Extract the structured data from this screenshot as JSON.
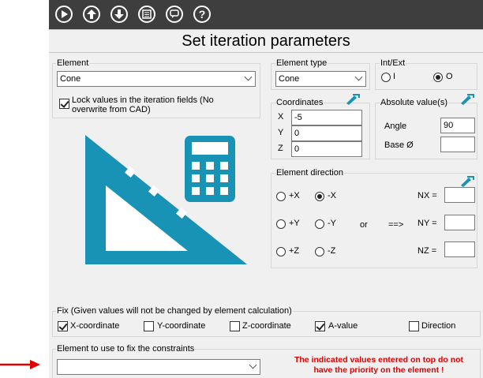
{
  "toolbar": {
    "buttons": [
      {
        "icon": "play-icon"
      },
      {
        "icon": "arrow-up-icon"
      },
      {
        "icon": "arrow-down-icon"
      },
      {
        "icon": "list-icon"
      },
      {
        "icon": "comment-icon"
      },
      {
        "icon": "help-icon",
        "glyph": "?"
      }
    ]
  },
  "title": "Set iteration parameters",
  "element": {
    "label": "Element",
    "value": "Cone",
    "lock_label": "Lock values in the iteration fields (No overwrite from CAD)",
    "lock_checked": true
  },
  "element_type": {
    "label": "Element type",
    "value": "Cone"
  },
  "int_ext": {
    "label": "Int/Ext",
    "options": [
      "I",
      "O"
    ],
    "selected": "O"
  },
  "coordinates": {
    "label": "Coordinates",
    "x_label": "X",
    "x_value": "-5",
    "y_label": "Y",
    "y_value": "0",
    "z_label": "Z",
    "z_value": "0"
  },
  "absolute_values": {
    "label": "Absolute value(s)",
    "angle_label": "Angle",
    "angle_value": "90",
    "base_label": "Base Ø",
    "base_value": ""
  },
  "direction": {
    "label": "Element direction",
    "px": "+X",
    "nx": "-X",
    "py": "+Y",
    "ny": "-Y",
    "pz": "+Z",
    "nz": "-Z",
    "selected": "-X",
    "or_label": "or",
    "arrow_label": "==>",
    "nx_label": "NX =",
    "ny_label": "NY =",
    "nz_label": "NZ =",
    "nx_value": "",
    "ny_value": "",
    "nz_value": ""
  },
  "fix": {
    "label": "Fix (Given values will not be changed by element calculation)",
    "x_label": "X-coordinate",
    "x_checked": true,
    "y_label": "Y-coordinate",
    "y_checked": false,
    "z_label": "Z-coordinate",
    "z_checked": false,
    "a_label": "A-value",
    "a_checked": true,
    "dir_label": "Direction",
    "dir_checked": false
  },
  "constraint": {
    "label": "Element to use to fix the constraints",
    "value": "",
    "warning_line1": "The indicated values entered on top do not",
    "warning_line2": "have the priority on the element !"
  },
  "colors": {
    "toolbar_bg": "#3e3e3e",
    "illustration": "#1893b6",
    "warning": "#e00000",
    "pointer_arrow": "#e00000"
  }
}
